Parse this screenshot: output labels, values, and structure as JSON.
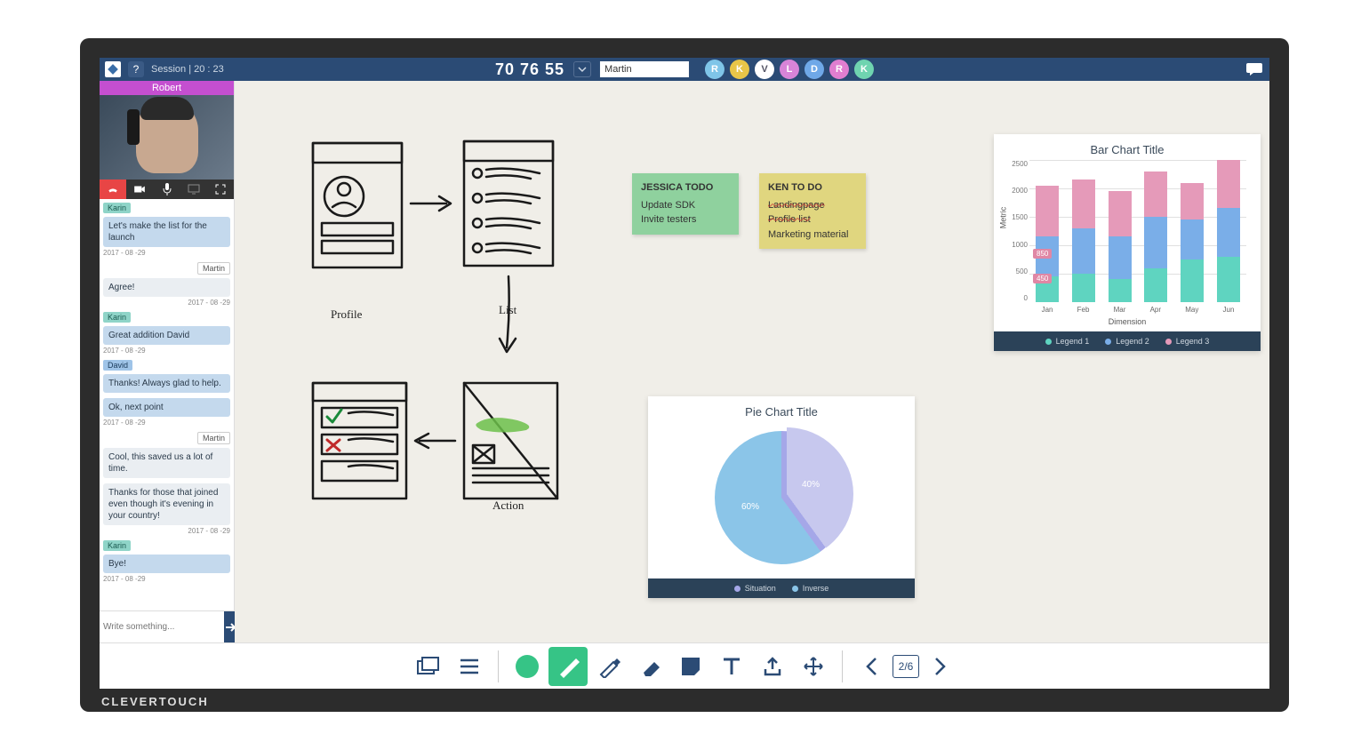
{
  "brand": "CLEVERTOUCH",
  "header": {
    "session_label": "Session | 20 : 23",
    "code": "70 76 55",
    "name_input": "Martin",
    "help": "?",
    "participants": [
      {
        "initial": "R",
        "color": "#7fc5e8"
      },
      {
        "initial": "K",
        "color": "#e8c548"
      },
      {
        "initial": "V",
        "color": "#ffffff",
        "fg": "#556"
      },
      {
        "initial": "L",
        "color": "#d884d8"
      },
      {
        "initial": "D",
        "color": "#6fa8e8"
      },
      {
        "initial": "R",
        "color": "#e07ed0"
      },
      {
        "initial": "K",
        "color": "#6fd4b0"
      }
    ]
  },
  "video": {
    "caller": "Robert"
  },
  "chat": {
    "messages": [
      {
        "sender": "Karin",
        "cls": "karin",
        "text": "Let's make the list for the launch",
        "time": "2017 - 08 -29",
        "side": "left"
      },
      {
        "sender": "Martin",
        "cls": "martin",
        "text": "Agree!",
        "time": "2017 - 08 -29",
        "side": "right"
      },
      {
        "sender": "Karin",
        "cls": "karin",
        "text": "Great addition David",
        "time": "2017 - 08 -29",
        "side": "left"
      },
      {
        "sender": "David",
        "cls": "david",
        "text": "Thanks!\nAlways glad to help.",
        "time": "",
        "side": "left"
      },
      {
        "sender": "",
        "cls": "",
        "text": "Ok, next point",
        "time": "2017 - 08 -29",
        "side": "left"
      },
      {
        "sender": "Martin",
        "cls": "martin",
        "text": "Cool, this saved us a lot of time.",
        "time": "",
        "side": "right-ish",
        "rightalign": false
      },
      {
        "sender": "",
        "cls": "martin",
        "text": "Thanks for those that joined even though it's evening in your country!",
        "time": "2017 - 08 -29",
        "side": "right-ish"
      },
      {
        "sender": "Karin",
        "cls": "karin",
        "text": "Bye!",
        "time": "2017 - 08 -29",
        "side": "left"
      }
    ],
    "placeholder": "Write something..."
  },
  "canvas": {
    "sketch_labels": {
      "profile": "Profile",
      "list": "List",
      "action": "Action"
    },
    "sticky_green": {
      "title": "JESSICA TODO",
      "l1": "Update SDK",
      "l2": "Invite testers"
    },
    "sticky_yellow": {
      "title": "KEN TO DO",
      "l1": "Landingpage",
      "l2": "Profile list",
      "l3": "Marketing material"
    }
  },
  "chart_data": [
    {
      "type": "bar",
      "title": "Bar Chart Title",
      "xlabel": "Dimension",
      "ylabel": "Metric",
      "ylim": [
        0,
        2500
      ],
      "categories": [
        "Jan",
        "Feb",
        "Mar",
        "Apr",
        "May",
        "Jun"
      ],
      "series": [
        {
          "name": "Legend 1",
          "color": "#5fd4c0",
          "values": [
            450,
            500,
            400,
            600,
            750,
            800
          ]
        },
        {
          "name": "Legend 2",
          "color": "#7aaee8",
          "values": [
            700,
            800,
            750,
            900,
            700,
            850
          ]
        },
        {
          "name": "Legend 3",
          "color": "#e59ab9",
          "values": [
            900,
            850,
            800,
            800,
            650,
            850
          ]
        }
      ],
      "annotations": [
        {
          "label": "850",
          "x": 0,
          "y": 850
        },
        {
          "label": "450",
          "x": 0,
          "y": 450
        }
      ]
    },
    {
      "type": "pie",
      "title": "Pie Chart Title",
      "series": [
        {
          "name": "Situation",
          "color": "#a5a7e8",
          "value": 40,
          "label": "40%"
        },
        {
          "name": "Inverse",
          "color": "#8bc5e8",
          "value": 60,
          "label": "60%"
        }
      ]
    }
  ],
  "toolbar": {
    "page": "2/6",
    "pen_color": "#36c486"
  }
}
